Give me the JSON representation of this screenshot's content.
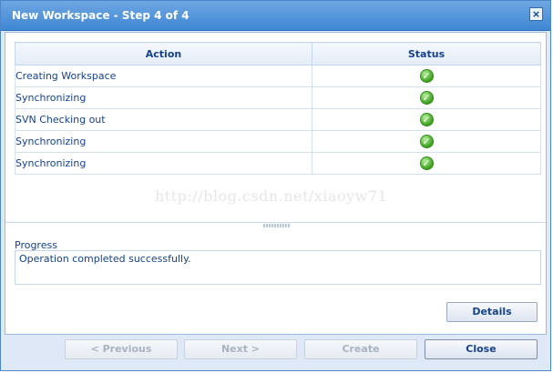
{
  "window": {
    "title": "New Workspace - Step 4 of 4",
    "close_glyph": "×"
  },
  "table": {
    "columns": [
      "Action",
      "Status"
    ],
    "rows": [
      {
        "action": "Creating Workspace",
        "status_icon": "check-icon"
      },
      {
        "action": "Synchronizing",
        "status_icon": "check-icon"
      },
      {
        "action": "SVN Checking out",
        "status_icon": "check-icon"
      },
      {
        "action": "Synchronizing",
        "status_icon": "check-icon"
      },
      {
        "action": "Synchronizing",
        "status_icon": "check-icon"
      }
    ]
  },
  "watermark": "http://blog.csdn.net/xiaoyw71",
  "progress": {
    "label": "Progress",
    "message": "Operation completed successfully."
  },
  "buttons": {
    "details": "Details",
    "previous": "< Previous",
    "next": "Next >",
    "create": "Create",
    "close": "Close"
  },
  "colors": {
    "title_bar": "#3f87d4",
    "text": "#15428b",
    "success": "#3ca31e"
  }
}
